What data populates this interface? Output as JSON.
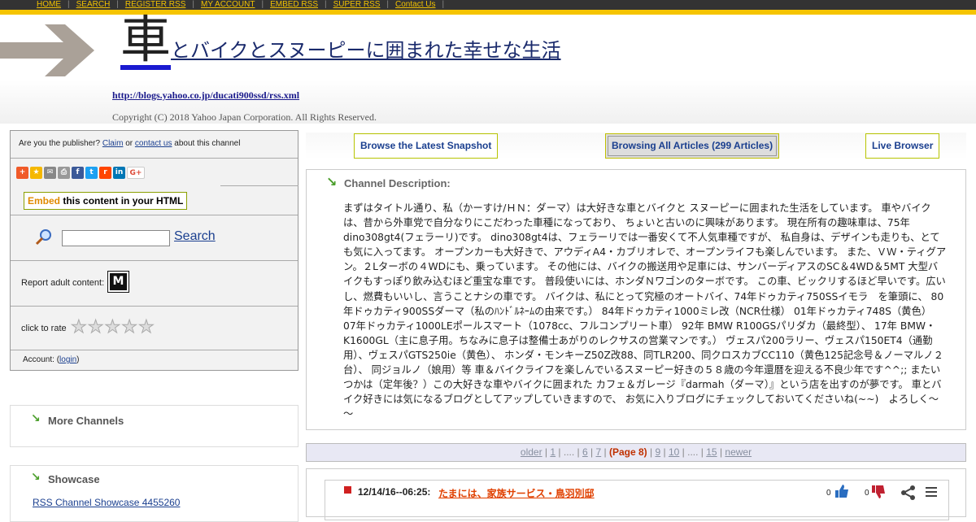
{
  "topnav": {
    "items": [
      "HOME",
      "SEARCH",
      "REGISTER RSS",
      "MY ACCOUNT",
      "EMBED RSS",
      "SUPER RSS",
      "Contact Us"
    ]
  },
  "header": {
    "title_big": "車",
    "title_rest": "とバイクとスヌーピーに囲まれた幸せな生活",
    "rss_url": "http://blogs.yahoo.co.jp/ducati900ssd/rss.xml",
    "copyright": "Copyright (C) 2018 Yahoo Japan Corporation. All Rights Reserved."
  },
  "sidebar": {
    "publisher_prefix": "Are you the publisher?",
    "claim": "Claim",
    "or": "or",
    "contact": "contact us",
    "publisher_suffix": "about this channel",
    "embed_word": "Embed",
    "embed_rest": "this content in your HTML",
    "search_placeholder": "",
    "search_label": "Search",
    "adult_label": "Report adult content:",
    "adult_badge": "M",
    "rate_label": "click to rate",
    "account_prefix": "Account: (",
    "account_link": "login",
    "account_suffix": ")",
    "more_channels": "More Channels",
    "showcase": "Showcase",
    "showcase_link": "RSS Channel Showcase 4455260"
  },
  "tabs": {
    "latest": "Browse the Latest Snapshot",
    "all": "Browsing All Articles (299 Articles)",
    "live": "Live Browser"
  },
  "description": {
    "title": "Channel Description:",
    "text": "まずはタイトル通り、私（かーすけ/ＨＮ：ダーマ）は大好きな車とバイクと スヌーピーに囲まれた生活をしています。 車やバイクは、昔から外車党で自分なりにこだわった車種になっており、 ちょいと古いのに興味があります。 現在所有の趣味車は、75年dino308gt4(フェラーリ)です。 dino308gt4は、フェラーリでは一番安くて不人気車種ですが、 私自身は、デザインも走りも、とても気に入ってます。 オープンカーも大好きで、アウディA4・カブリオレで、オープンライフも楽しんでいます。 また、ＶＷ・ティグアン。２Lターボの４WDにも、乗っています。 その他には、バイクの搬送用や足車には、サンバーディアスのSC＆4WD＆5MT 大型バイクもすっぽり飲み込むほど重宝な車です。 普段使いには、ホンダＮワゴンのターボです。 この車、ビックリするほど早いです。広いし、燃費もいいし、言うことナシの車です。 バイクは、私にとって究極のオートバイ、74年ドゥカティ750SSイモラ　を筆頭に、 80年ドゥカティ900SSダーマ（私のﾊﾝﾄﾞﾙﾈｰﾑの由来です。） 84年ドゥカティ1000ミレ改（NCR仕様） 01年ドゥカティ748S（黄色） 07年ドゥカティ1000LEポールスマート（1078cc、フルコンプリート車） 92年 BMW R100GSパリダカ（最終型）、 17年 BMW・K1600GL（主に息子用。ちなみに息子は整備士あがりのレクサスの営業マンです。） ヴェスパ200ラリー、ヴェスパ150ET4（通勤用）、ヴェスパGTS250ie（黄色）、 ホンダ・モンキーZ50Z改88、同TLR200、同クロスカブCC110（黄色125記念号＆ノーマルノ２台）、 同ジョルノ（娘用）等 車＆バイクライフを楽しんでいるスヌーピー好きの５８歳の今年還暦を迎える不良少年です^^;; またいつかは（定年後？）この大好きな車やバイクに囲まれた カフェ＆ガレージ『darmah（ダーマ）』という店を出すのが夢です。 車とバイク好きには気になるブログとしてアップしていきますので、 お気に入りブログにチェックしておいてくださいね(~~)　よろしく～～"
  },
  "pager": {
    "older": "older",
    "p1": "1",
    "dots1": "....",
    "p6": "6",
    "p7": "7",
    "current": "(Page 8)",
    "p9": "9",
    "p10": "10",
    "dots2": "....",
    "p15": "15",
    "newer": "newer"
  },
  "article": {
    "date": "12/14/16--06:25:",
    "title": "たまには、家族サービス・鳥羽別邸",
    "likes": "0",
    "dislikes": "0"
  },
  "colors": {
    "topnav_bg": "#333333",
    "topnav_link": "#f2c200",
    "accent_yellow": "#f5c400",
    "article_title": "#e04000",
    "pager_current": "#c03000"
  }
}
